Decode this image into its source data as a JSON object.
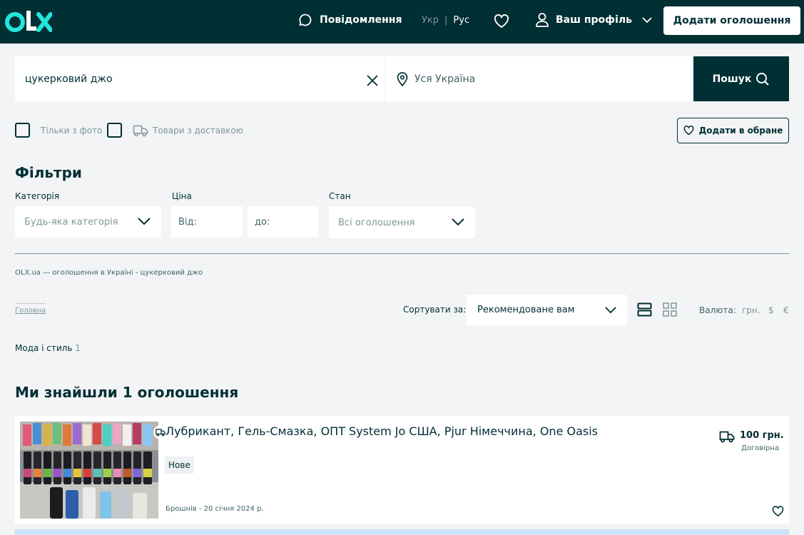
{
  "header": {
    "messages_label": "Повідомлення",
    "lang_ukr": "Укр",
    "lang_sep": "|",
    "lang_rus": "Рус",
    "profile_label": "Ваш профіль",
    "post_ad_label": "Додати оголошення"
  },
  "search": {
    "query": "цукерковий джо",
    "location": "Уся Україна",
    "button_label": "Пошук"
  },
  "options": {
    "only_photo": "Тільки з фото",
    "with_delivery": "Товари з доставкою",
    "add_favorite": "Додати в обране"
  },
  "filters": {
    "title": "Фільтри",
    "category_label": "Категорія",
    "category_value": "Будь-яка категорія",
    "price_label": "Ціна",
    "price_from": "Від:",
    "price_to": "до:",
    "condition_label": "Стан",
    "condition_value": "Всі оголошення"
  },
  "breadcrumb": {
    "page_heading": "OLX.ua — оголошення в Україні - цукерковий джо",
    "home": "Головна"
  },
  "sort": {
    "label": "Сортувати за:",
    "value": "Рекомендоване вам",
    "currency_label": "Валюта:",
    "currencies": [
      "грн.",
      "$",
      "€"
    ]
  },
  "category_result": {
    "name": "Мода і стиль",
    "count": "1"
  },
  "results": {
    "heading": "Ми знайшли 1 оголошення"
  },
  "listing": {
    "title": "Лубрикант, Гель-Смазка, ОПТ System Jo США, Pjur Німеччина, One Oasis",
    "condition": "Нове",
    "location_date": "Брошнів - 20 січня 2024 р.",
    "price": "100 грн.",
    "negotiable": "Договірна"
  },
  "colors": {
    "brand_dark": "#002f34",
    "background": "#f2f4f5",
    "muted": "#7f9799",
    "logo_teal": "#23e5db"
  },
  "icons": [
    "olx-logo",
    "chat-icon",
    "heart-icon",
    "user-icon",
    "chevron-down-icon",
    "close-icon",
    "location-pin-icon",
    "search-icon",
    "truck-icon",
    "list-view-icon",
    "grid-view-icon"
  ]
}
